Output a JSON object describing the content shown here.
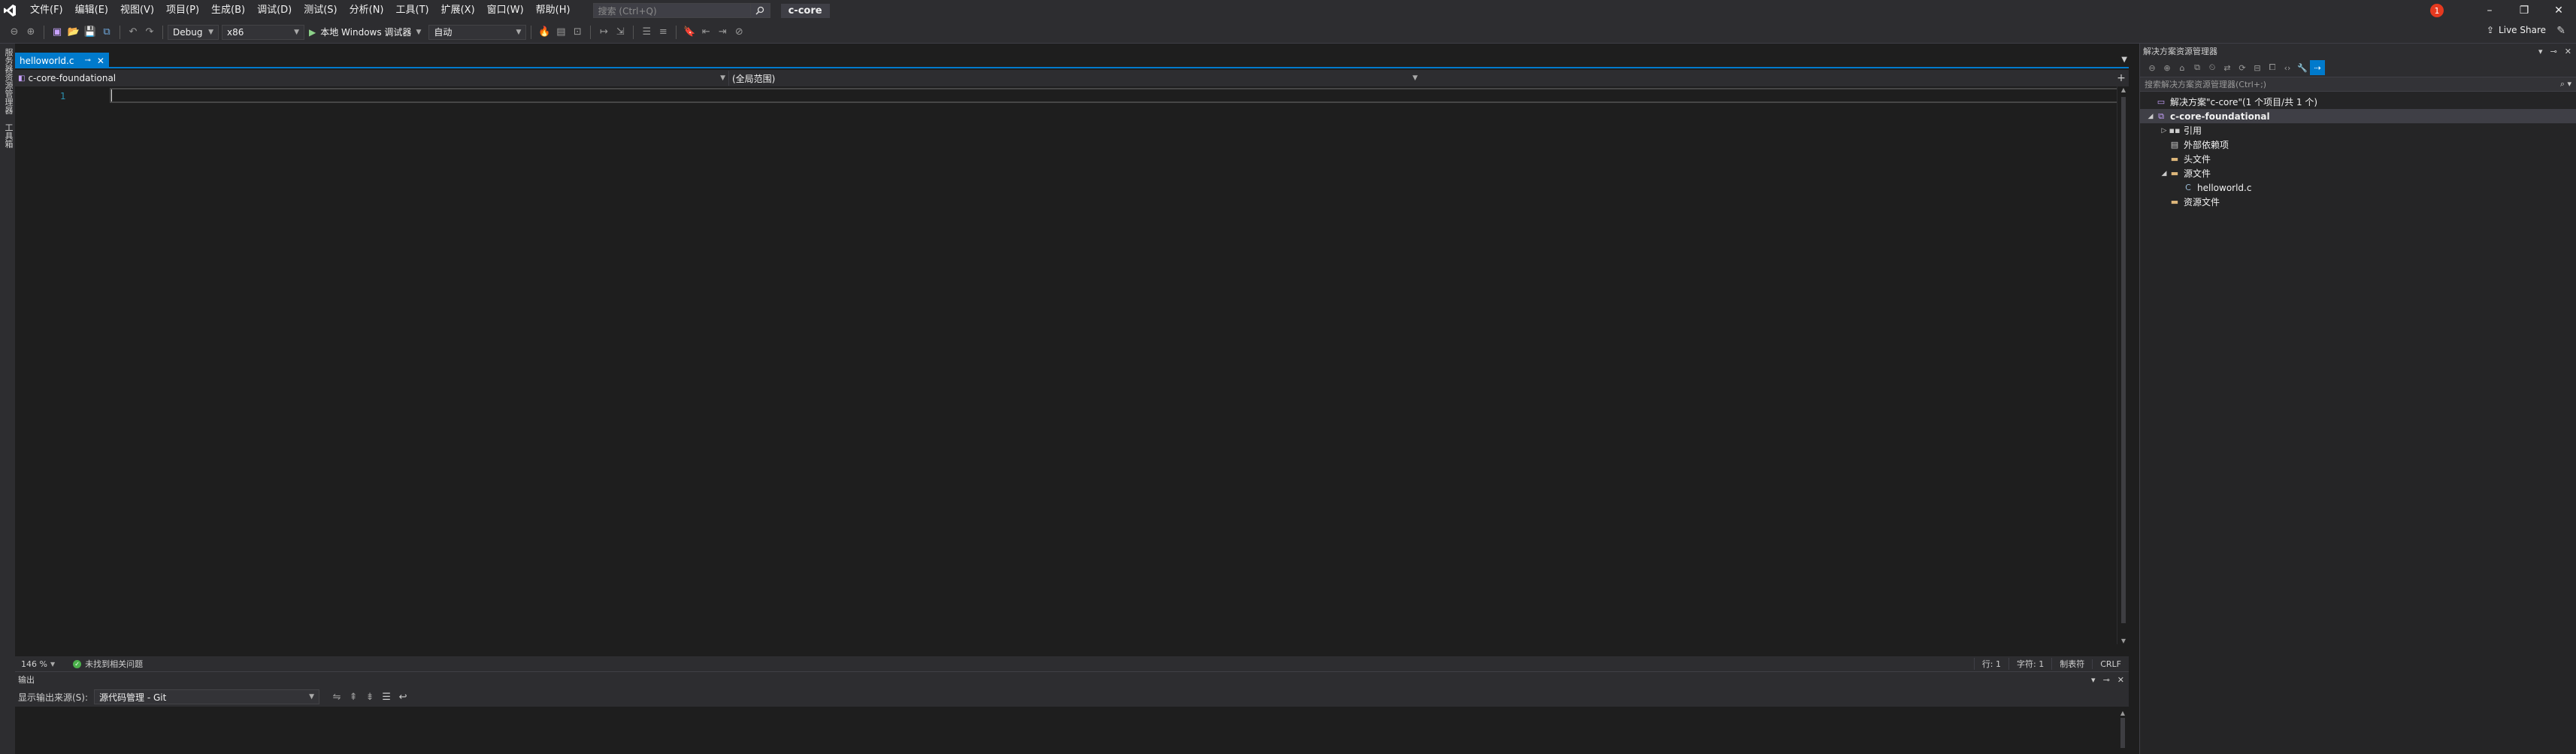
{
  "menubar": {
    "items": [
      "文件(F)",
      "编辑(E)",
      "视图(V)",
      "项目(P)",
      "生成(B)",
      "调试(D)",
      "测试(S)",
      "分析(N)",
      "工具(T)",
      "扩展(X)",
      "窗口(W)",
      "帮助(H)"
    ],
    "search_placeholder": "搜索 (Ctrl+Q)",
    "app_title": "c-core",
    "profile_initial": "1"
  },
  "toolbar": {
    "config": "Debug",
    "platform": "x86",
    "run_label": "本地 Windows 调试器",
    "run_mode": "自动",
    "liveshare": "Live Share"
  },
  "left_strip": {
    "tabs": [
      "服务器资源管理器",
      "工具箱"
    ]
  },
  "editor": {
    "tab_title": "helloworld.c",
    "nav_project": "c-core-foundational",
    "nav_scope": "(全局范围)",
    "line_number": "1",
    "zoom": "146 %",
    "issues": "未找到相关问题",
    "status": {
      "line": "行: 1",
      "col": "字符: 1",
      "tabs": "制表符",
      "eol": "CRLF"
    }
  },
  "output": {
    "title": "输出",
    "source_label": "显示输出来源(S):",
    "source_value": "源代码管理 - Git"
  },
  "solution_explorer": {
    "title": "解决方案资源管理器",
    "search_placeholder": "搜索解决方案资源管理器(Ctrl+;)",
    "tree": [
      {
        "label": "解决方案\"c-core\"(1 个项目/共 1 个)",
        "indent": 0,
        "twisty": "",
        "icon": "solution-icon"
      },
      {
        "label": "c-core-foundational",
        "indent": 0,
        "twisty": "◢",
        "icon": "project-icon"
      },
      {
        "label": "引用",
        "indent": 1,
        "twisty": "▷",
        "icon": "references-icon"
      },
      {
        "label": "外部依赖项",
        "indent": 1,
        "twisty": "",
        "icon": "external-deps-icon"
      },
      {
        "label": "头文件",
        "indent": 1,
        "twisty": "",
        "icon": "folder-icon"
      },
      {
        "label": "源文件",
        "indent": 1,
        "twisty": "◢",
        "icon": "folder-icon"
      },
      {
        "label": "helloworld.c",
        "indent": 2,
        "twisty": "",
        "icon": "c-file-icon"
      },
      {
        "label": "资源文件",
        "indent": 1,
        "twisty": "",
        "icon": "folder-icon"
      }
    ]
  },
  "colors": {
    "accent": "#007acc",
    "chrome": "#2d2d30",
    "editor_bg": "#1e1e1e",
    "line_number": "#2b91af"
  }
}
